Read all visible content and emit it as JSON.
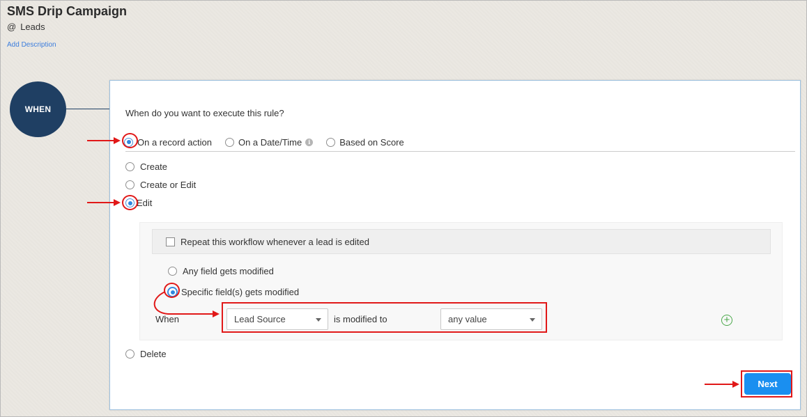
{
  "header": {
    "title": "SMS Drip Campaign",
    "module_at": "@",
    "module": "Leads",
    "add_description": "Add Description"
  },
  "stage": {
    "label": "WHEN"
  },
  "question": "When do you want to execute this rule?",
  "trigger_types": [
    {
      "label": "On a record action",
      "selected": true
    },
    {
      "label": "On a Date/Time",
      "selected": false,
      "info_icon": "info-icon"
    },
    {
      "label": "Based on Score",
      "selected": false
    }
  ],
  "actions": {
    "create": "Create",
    "create_or_edit": "Create or Edit",
    "edit": "Edit",
    "delete": "Delete",
    "selected": "Edit"
  },
  "edit_options": {
    "repeat_label": "Repeat this workflow whenever a lead is edited",
    "repeat_checked": false,
    "any_field": "Any field gets modified",
    "specific_fields": "Specific field(s) gets modified",
    "selected": "Specific field(s) gets modified",
    "condition": {
      "when_label": "When",
      "field": "Lead Source",
      "operator_text": "is modified to",
      "value": "any value"
    }
  },
  "next_button": "Next",
  "colors": {
    "accent": "#1a8ff0",
    "stage_circle": "#1f3f63",
    "annotation": "#e11818",
    "add_icon": "#4aa84a"
  }
}
